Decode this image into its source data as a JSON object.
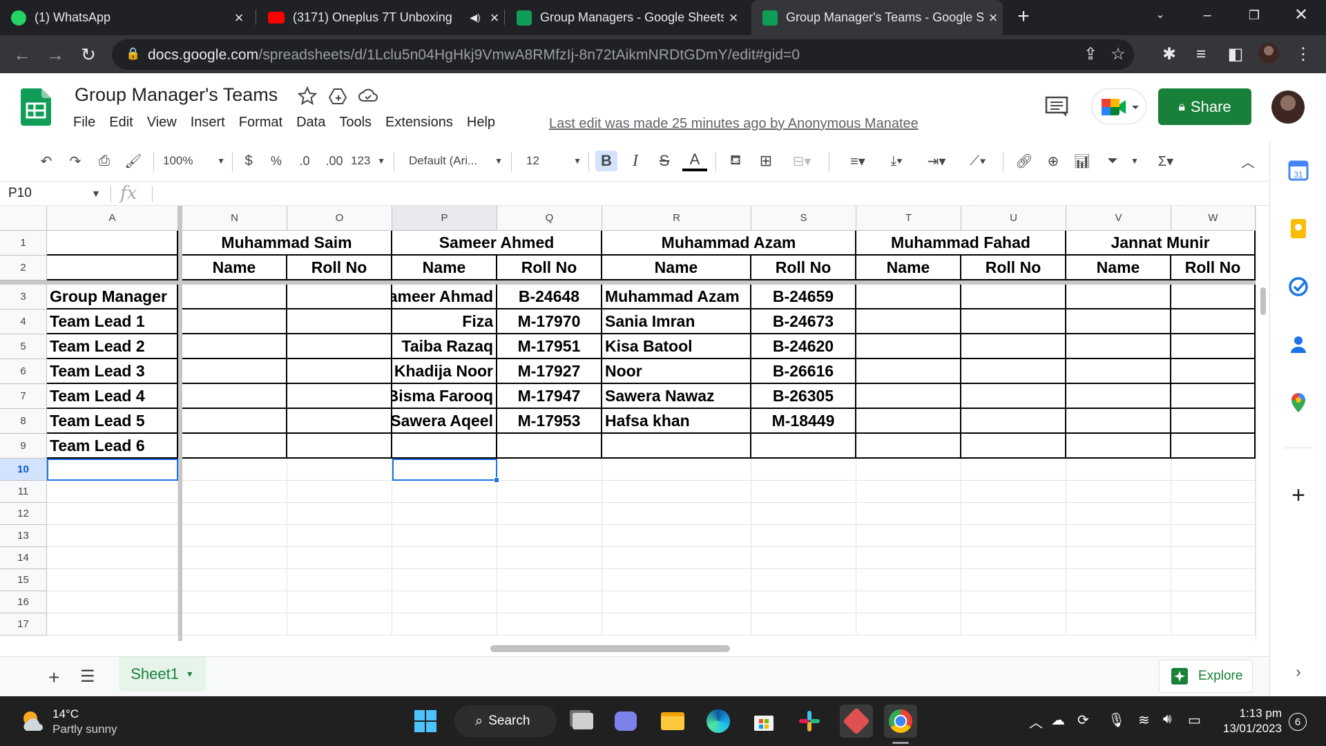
{
  "browser": {
    "tabs": [
      {
        "title": "(1) WhatsApp",
        "icon": "whatsapp-icon",
        "color": "#25d366"
      },
      {
        "title": "(3171) Oneplus 7T Unboxing",
        "icon": "youtube-icon",
        "color": "#ff0000"
      },
      {
        "title": "Group Managers - Google Sheets",
        "icon": "sheets-icon",
        "color": "#0f9d58"
      },
      {
        "title": "Group Manager's Teams - Google Sheets",
        "icon": "sheets-icon",
        "color": "#0f9d58"
      }
    ],
    "active_tab": 3,
    "url_domain": "docs.google.com",
    "url_path": "/spreadsheets/d/1Lclu5n04HgHkj9VmwA8RMfzIj-8n72tAikmNRDtGDmY/edit#gid=0"
  },
  "doc": {
    "title": "Group Manager's Teams",
    "menu": [
      "File",
      "Edit",
      "View",
      "Insert",
      "Format",
      "Data",
      "Tools",
      "Extensions",
      "Help"
    ],
    "last_edit": "Last edit was made 25 minutes ago by Anonymous Manatee",
    "share_label": "Share"
  },
  "toolbar": {
    "zoom": "100%",
    "currency": "$",
    "percent": "%",
    "dec_decrease": ".0",
    "dec_increase": ".00",
    "more_formats": "123",
    "font": "Default (Ari...",
    "font_size": "12",
    "bold": "B",
    "italic": "I",
    "strike": "S",
    "text_color": "A"
  },
  "formula_bar": {
    "name_box": "P10",
    "fx": "fx"
  },
  "grid": {
    "columns": [
      "A",
      "N",
      "O",
      "P",
      "Q",
      "R",
      "S",
      "T",
      "U",
      "V",
      "W"
    ],
    "selected_column": "P",
    "row_numbers": [
      "1",
      "2",
      "3",
      "4",
      "5",
      "6",
      "7",
      "8",
      "9",
      "10",
      "11",
      "12",
      "13",
      "14",
      "15",
      "16",
      "17"
    ],
    "selected_row": "10",
    "group_headers": [
      "Muhammad Saim",
      "Sameer Ahmed",
      "Muhammad Azam",
      "Muhammad Fahad",
      "Jannat Munir"
    ],
    "sub_headers": [
      "Name",
      "Roll No",
      "Name",
      "Roll No",
      "Name",
      "Roll No",
      "Name",
      "Roll No",
      "Name",
      "Roll No"
    ],
    "roles": [
      "Group Manager",
      "Team Lead 1",
      "Team Lead 2",
      "Team Lead 3",
      "Team Lead 4",
      "Team Lead 5",
      "Team Lead 6"
    ],
    "rows": [
      [
        "",
        "",
        "Sameer Ahmad",
        "B-24648",
        "Muhammad Azam",
        "B-24659",
        "",
        "",
        "",
        ""
      ],
      [
        "",
        "",
        "Fiza",
        "M-17970",
        "Sania Imran",
        "B-24673",
        "",
        "",
        "",
        ""
      ],
      [
        "",
        "",
        "Taiba Razaq",
        "M-17951",
        "Kisa Batool",
        "B-24620",
        "",
        "",
        "",
        ""
      ],
      [
        "",
        "",
        "Khadija Noor",
        "M-17927",
        "Noor",
        "B-26616",
        "",
        "",
        "",
        ""
      ],
      [
        "",
        "",
        "Bisma Farooq",
        "M-17947",
        "Sawera Nawaz",
        "B-26305",
        "",
        "",
        "",
        ""
      ],
      [
        "",
        "",
        "Sawera Aqeel",
        "M-17953",
        "Hafsa khan",
        "M-18449",
        "",
        "",
        "",
        ""
      ],
      [
        "",
        "",
        "",
        "",
        "",
        "",
        "",
        "",
        "",
        ""
      ]
    ]
  },
  "sheets": {
    "current": "Sheet1",
    "explore_label": "Explore"
  },
  "taskbar": {
    "weather_temp": "14°C",
    "weather_desc": "Partly sunny",
    "search_label": "Search",
    "time": "1:13 pm",
    "date": "13/01/2023",
    "notifications": "6"
  }
}
